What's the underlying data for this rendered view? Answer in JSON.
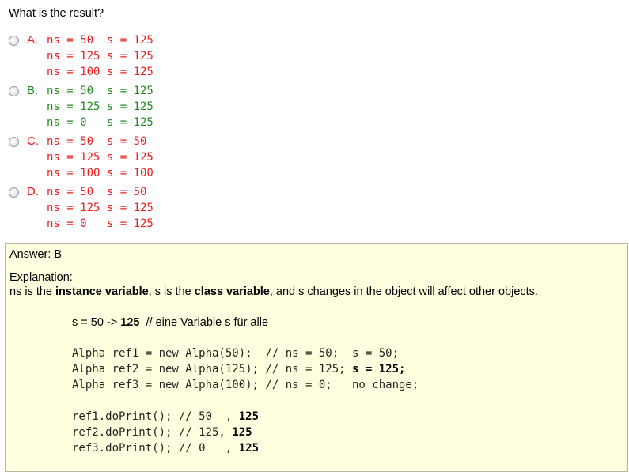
{
  "question": "What is the result?",
  "options": [
    {
      "letter": "A.",
      "lines": [
        "ns = 50  s = 125",
        "ns = 125 s = 125",
        "ns = 100 s = 125"
      ],
      "color": "#ee1c1c"
    },
    {
      "letter": "B.",
      "lines": [
        "ns = 50  s = 125",
        "ns = 125 s = 125",
        "ns = 0   s = 125"
      ],
      "color": "#1f8a1f"
    },
    {
      "letter": "C.",
      "lines": [
        "ns = 50  s = 50",
        "ns = 125 s = 125",
        "ns = 100 s = 100"
      ],
      "color": "#ee1c1c"
    },
    {
      "letter": "D.",
      "lines": [
        "ns = 50  s = 50",
        "ns = 125 s = 125",
        "ns = 0   s = 125"
      ],
      "color": "#ee1c1c"
    }
  ],
  "answer": "Answer: B",
  "explanation": {
    "heading": "Explanation:",
    "t1": "ns is the ",
    "b1": "instance variable",
    "t2": ", s is the ",
    "b2": "class variable",
    "t3": ", and s changes in the object will affect other objects.",
    "inline_pre": "s = 50 -> ",
    "inline_bold": "125",
    "inline_post": "  // eine Variable s für alle",
    "code1": [
      {
        "pre": "Alpha ref1 = new Alpha(50);  // ns = 50;  s = 50;",
        "bold": "",
        "post": ""
      },
      {
        "pre": "Alpha ref2 = new Alpha(125); // ns = 125; ",
        "bold": "s = 125;",
        "post": ""
      },
      {
        "pre": "Alpha ref3 = new Alpha(100); // ns = 0;   no change;",
        "bold": "",
        "post": ""
      }
    ],
    "code2": [
      {
        "pre": "ref1.doPrint(); // 50  , ",
        "bold": "125"
      },
      {
        "pre": "ref2.doPrint(); // 125, ",
        "bold": "125"
      },
      {
        "pre": "ref3.doPrint(); // 0   , ",
        "bold": "125"
      }
    ]
  }
}
